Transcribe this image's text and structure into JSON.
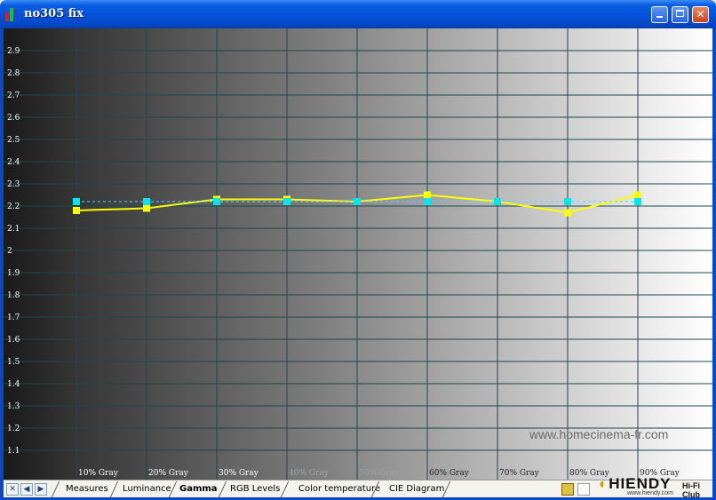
{
  "window": {
    "title": "no305 fix",
    "minimize_icon": "minimize-icon",
    "maximize_icon": "maximize-icon",
    "close_icon": "close-icon"
  },
  "tabs": {
    "items": [
      {
        "label": "Measures",
        "active": false
      },
      {
        "label": "Luminance",
        "active": false
      },
      {
        "label": "Gamma",
        "active": true
      },
      {
        "label": "RGB Levels",
        "active": false
      },
      {
        "label": "Color temperature",
        "active": false
      },
      {
        "label": "CIE Diagram",
        "active": false
      }
    ]
  },
  "watermark": {
    "text": "www.homecinema-fr.com",
    "logo": "HIENDY",
    "logo_sub": "Hi-Fi Club",
    "logo_url": "www.hiendy.com"
  },
  "chart_data": {
    "type": "line",
    "title": "",
    "xlabel": "",
    "ylabel": "",
    "categories": [
      "10% Gray",
      "20% Gray",
      "30% Gray",
      "40% Gray",
      "50% Gray",
      "60% Gray",
      "70% Gray",
      "80% Gray",
      "90% Gray"
    ],
    "ylim": [
      1.0,
      3.0
    ],
    "yticks": [
      "1.1",
      "1.2",
      "1.3",
      "1.4",
      "1.5",
      "1.6",
      "1.7",
      "1.8",
      "1.9",
      "2",
      "2.1",
      "2.2",
      "2.3",
      "2.4",
      "2.5",
      "2.6",
      "2.7",
      "2.8",
      "2.9"
    ],
    "grid": true,
    "background": "grayscale-ramp",
    "series": [
      {
        "values": [
          2.18,
          2.19,
          2.23,
          2.23,
          2.22,
          2.25,
          2.22,
          2.17,
          2.25
        ],
        "color": "#ffff00",
        "marker_color": "#ffff00",
        "style": "solid"
      },
      {
        "values": [
          2.22,
          2.22,
          2.22,
          2.22,
          2.22,
          2.22,
          2.22,
          2.22,
          2.22
        ],
        "color": "#66ccff",
        "marker_color": "#00e5ee",
        "style": "dashed"
      }
    ],
    "grid_color": "#1e4a4a",
    "axis_label_color": "#ffffff"
  }
}
